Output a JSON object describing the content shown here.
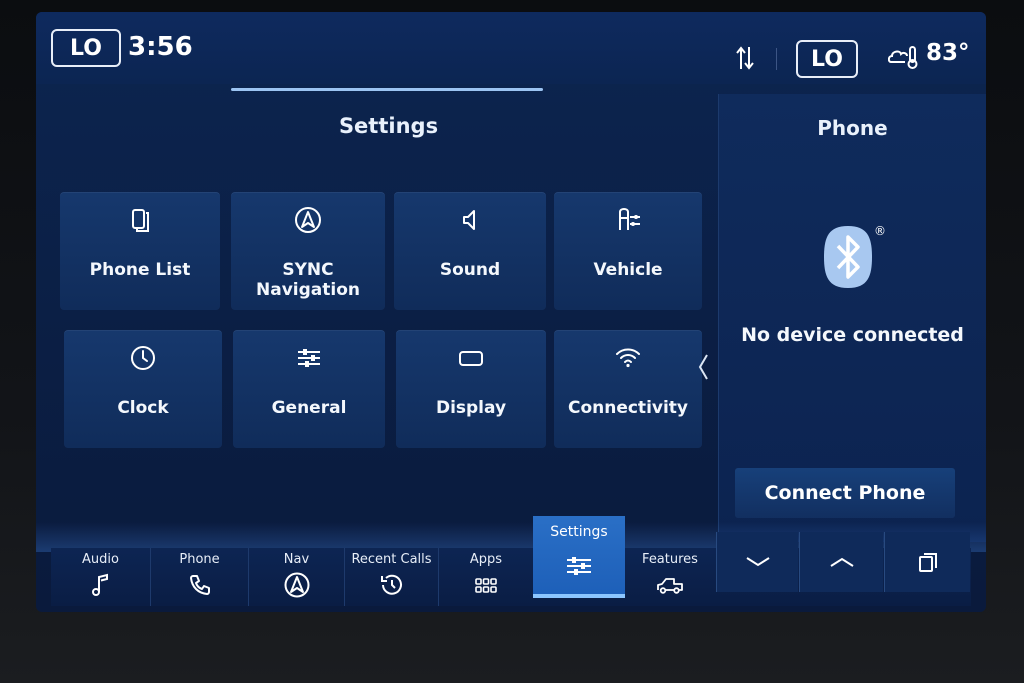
{
  "status": {
    "climate_left": "LO",
    "clock": "3:56",
    "climate_right": "LO",
    "outside_temp": "83°",
    "icons": [
      "sort-arrows-icon",
      "weather-thermometer-icon"
    ]
  },
  "settings": {
    "title": "Settings",
    "page_indicator": {
      "total": 2,
      "current": 1
    },
    "tiles": [
      {
        "label": "Phone List",
        "icon": "phone-list-icon"
      },
      {
        "label": "SYNC Navigation",
        "icon": "navigation-icon"
      },
      {
        "label": "Sound",
        "icon": "speaker-icon"
      },
      {
        "label": "Vehicle",
        "icon": "vehicle-settings-icon"
      },
      {
        "label": "Clock",
        "icon": "clock-icon"
      },
      {
        "label": "General",
        "icon": "sliders-icon"
      },
      {
        "label": "Display",
        "icon": "display-icon"
      },
      {
        "label": "Connectivity",
        "icon": "wifi-icon"
      }
    ]
  },
  "phone": {
    "title": "Phone",
    "status": "No device connected",
    "registered_mark": "®",
    "connect_button": "Connect Phone"
  },
  "nav": {
    "items": [
      {
        "label": "Audio",
        "icon": "music-note-icon"
      },
      {
        "label": "Phone",
        "icon": "phone-icon"
      },
      {
        "label": "Nav",
        "icon": "navigation-icon"
      },
      {
        "label": "Recent Calls",
        "icon": "history-clock-icon"
      },
      {
        "label": "Apps",
        "icon": "apps-grid-icon"
      },
      {
        "label": "Settings",
        "icon": "sliders-icon",
        "active": true
      },
      {
        "label": "Features",
        "icon": "truck-icon"
      }
    ],
    "controls": [
      "chevron-down-icon",
      "chevron-up-icon",
      "copy-windows-icon"
    ]
  },
  "colors": {
    "background": "#0b1f45",
    "tile": "#133263",
    "active_tab": "#2a6fc6",
    "bluetooth": "#a8c8f0"
  }
}
